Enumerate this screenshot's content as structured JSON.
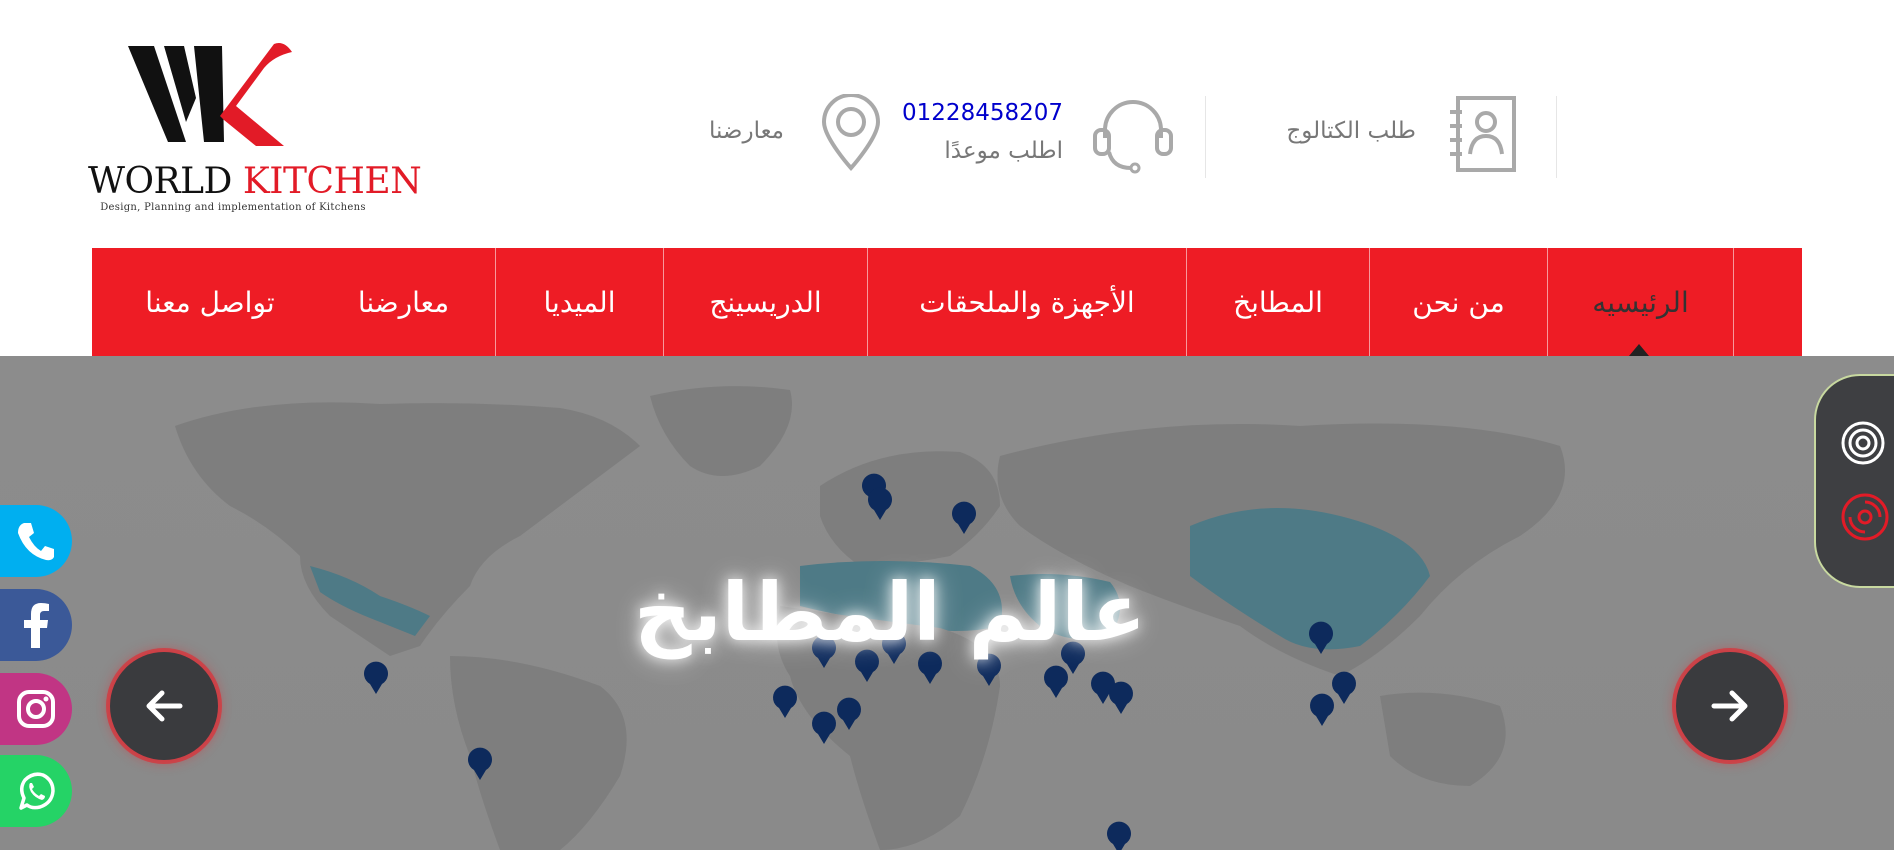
{
  "logo": {
    "brand_word1": "WORLD",
    "brand_word2": "KITCHEN",
    "tagline": "Design, Planning and implementation of Kitchens"
  },
  "header": {
    "showrooms_label": "معارضنا",
    "phone": "01228458207",
    "appointment_label": "اطلب موعدًا",
    "catalog_label": "طلب الكتالوج"
  },
  "nav": {
    "items": [
      {
        "label": "الرئيسيه"
      },
      {
        "label": "من نحن"
      },
      {
        "label": "المطابخ"
      },
      {
        "label": "الأجهزة والملحقات"
      },
      {
        "label": "الدريسينج"
      },
      {
        "label": "الميديا"
      },
      {
        "label": "معارضنا"
      },
      {
        "label": "تواصل معنا"
      }
    ],
    "active_index": 0
  },
  "hero": {
    "title": "عالم المطابخ"
  },
  "icons": {
    "map_pin": "map-pin-icon",
    "headset": "headset-icon",
    "catalog": "contact-book-icon",
    "prev": "arrow-left-icon",
    "next": "arrow-right-icon",
    "target": "target-icon",
    "disc": "disc-icon",
    "phone": "phone-icon",
    "facebook": "facebook-icon",
    "instagram": "instagram-icon",
    "whatsapp": "whatsapp-icon"
  },
  "colors": {
    "brand_red": "#ee1c25",
    "phone_blue": "#0000cc",
    "hero_gray": "#8c8c8c",
    "map_highlight": "#4e7a86",
    "pin_navy": "#0d2a5c",
    "phone_btn": "#00aff0",
    "facebook_btn": "#3b5998",
    "instagram_btn": "#c13584",
    "whatsapp_btn": "#25d366"
  }
}
